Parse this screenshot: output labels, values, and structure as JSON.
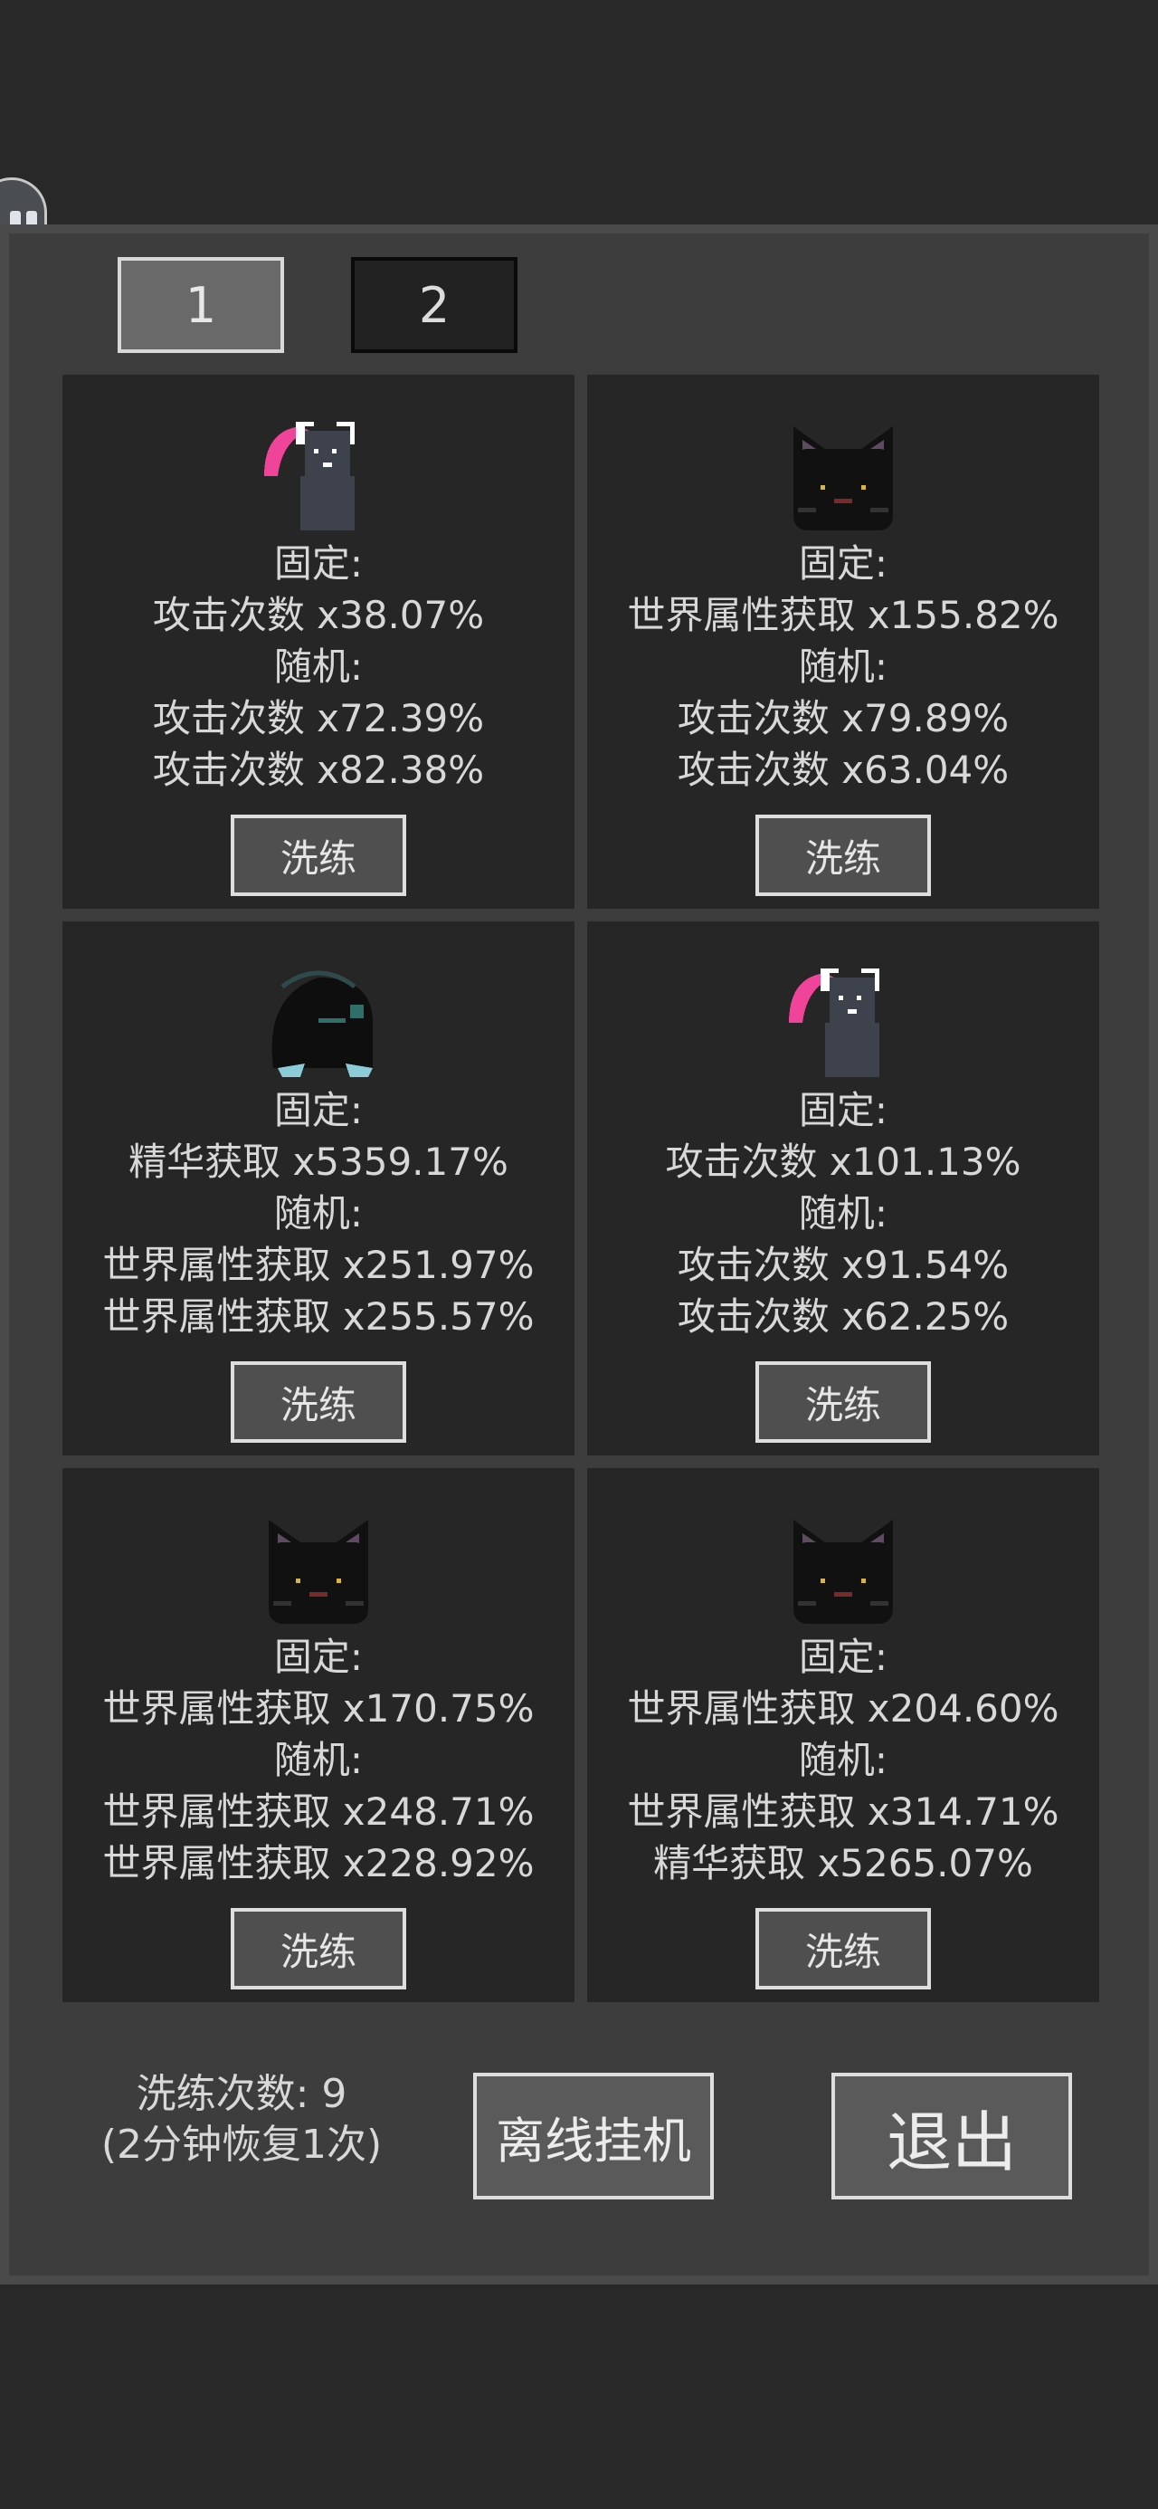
{
  "tabs": [
    {
      "label": "1",
      "active": true
    },
    {
      "label": "2",
      "active": false
    }
  ],
  "cards": [
    {
      "pet_icon": "scythe-cat-icon",
      "fixed_label": "固定:",
      "fixed_value": "攻击次数 x38.07%",
      "random_label": "随机:",
      "random_values": [
        "攻击次数 x72.39%",
        "攻击次数 x82.38%"
      ],
      "button": "洗练"
    },
    {
      "pet_icon": "black-cat-icon",
      "fixed_label": "固定:",
      "fixed_value": "世界属性获取 x155.82%",
      "random_label": "随机:",
      "random_values": [
        "攻击次数 x79.89%",
        "攻击次数 x63.04%"
      ],
      "button": "洗练"
    },
    {
      "pet_icon": "hooded-beast-icon",
      "fixed_label": "固定:",
      "fixed_value": "精华获取 x5359.17%",
      "random_label": "随机:",
      "random_values": [
        "世界属性获取 x251.97%",
        "世界属性获取 x255.57%"
      ],
      "button": "洗练"
    },
    {
      "pet_icon": "scythe-cat-icon",
      "fixed_label": "固定:",
      "fixed_value": "攻击次数 x101.13%",
      "random_label": "随机:",
      "random_values": [
        "攻击次数 x91.54%",
        "攻击次数 x62.25%"
      ],
      "button": "洗练"
    },
    {
      "pet_icon": "black-cat-icon",
      "fixed_label": "固定:",
      "fixed_value": "世界属性获取 x170.75%",
      "random_label": "随机:",
      "random_values": [
        "世界属性获取 x248.71%",
        "世界属性获取 x228.92%"
      ],
      "button": "洗练"
    },
    {
      "pet_icon": "black-cat-icon",
      "fixed_label": "固定:",
      "fixed_value": "世界属性获取 x204.60%",
      "random_label": "随机:",
      "random_values": [
        "世界属性获取 x314.71%",
        "精华获取 x5265.07%"
      ],
      "button": "洗练"
    }
  ],
  "footer": {
    "refine_count": "洗练次数: 9",
    "recovery": "(2分钟恢复1次)",
    "offline_button": "离线挂机",
    "exit_button": "退出"
  },
  "colors": {
    "background": "#282828",
    "panel": "#3d3d3d",
    "card": "#262626",
    "scythe_pink": "#f0449a"
  }
}
